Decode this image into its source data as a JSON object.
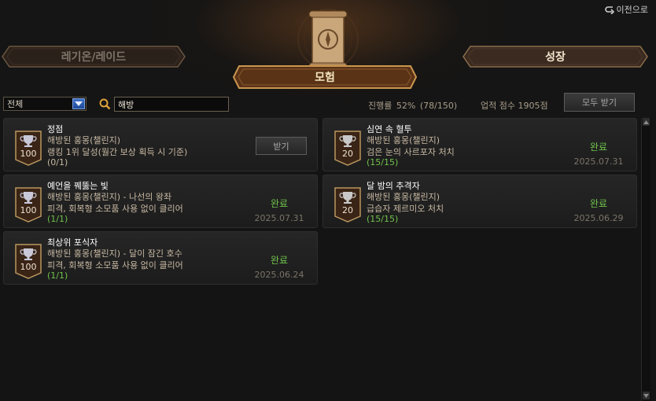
{
  "header": {
    "back_label": "이전으로",
    "tabs": {
      "legion_raid": "레기온/레이드",
      "adventure": "모험",
      "growth": "성장"
    }
  },
  "filter": {
    "category_selected": "전체",
    "search_value": "해방",
    "progress_label": "진행률",
    "progress_percent": "52%",
    "progress_count": "(78/150)",
    "score_label": "업적 점수",
    "score_value": "1905점",
    "claim_all_label": "모두 받기"
  },
  "achievements": [
    {
      "title": "정점",
      "line1": "해방된 홍몽(챌린지)",
      "line2": "랭킹 1위 달성(월간 보상 획득 시 기준)",
      "count": "(0/1)",
      "points": "100",
      "button_label": "받기"
    },
    {
      "title": "심연 속 혈투",
      "line1": "해방된 홍몽(챌린지)",
      "line2": "검은 눈의 사르포자 처치",
      "count": "(15/15)",
      "points": "20",
      "status": "완료",
      "date": "2025.07.31"
    },
    {
      "title": "예언을 꿰뚫는 빛",
      "line1": "해방된 홍몽(챌린지) - 나선의 왕좌",
      "line2": "피격, 회복형 소모품 사용 없이 클리어",
      "count": "(1/1)",
      "points": "100",
      "status": "완료",
      "date": "2025.07.31"
    },
    {
      "title": "달 밤의 추격자",
      "line1": "해방된 홍몽(챌린지)",
      "line2": "급습자 제르미오 처치",
      "count": "(15/15)",
      "points": "20",
      "status": "완료",
      "date": "2025.06.29"
    },
    {
      "title": "최상위 포식자",
      "line1": "해방된 홍몽(챌린지) - 달이 잠긴 호수",
      "line2": "피격, 회복형 소모품 사용 없이 클리어",
      "count": "(1/1)",
      "points": "100",
      "status": "완료",
      "date": "2025.06.24"
    }
  ],
  "colors": {
    "complete_green": "#6fc24a",
    "badge_brown": "#3a2416",
    "badge_gold": "#b9965f"
  },
  "icons": [
    "back-arrow-icon",
    "scroll-compass-icon",
    "search-icon",
    "dropdown-arrow-icon",
    "trophy-icon"
  ]
}
